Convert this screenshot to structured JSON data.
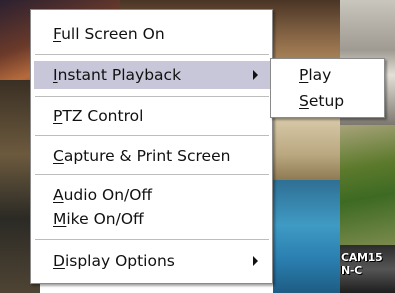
{
  "background": {
    "camera_label": "CAM15 N-C"
  },
  "menu": {
    "items": [
      {
        "first": "F",
        "rest": "ull Screen On",
        "has_submenu": false
      },
      {
        "first": "I",
        "rest": "nstant Playback",
        "has_submenu": true,
        "highlighted": true
      },
      {
        "first": "P",
        "rest": "TZ Control",
        "has_submenu": false
      },
      {
        "first": "C",
        "rest": "apture & Print Screen",
        "has_submenu": false
      },
      {
        "first": "A",
        "rest": "udio On/Off",
        "has_submenu": false
      },
      {
        "first": "M",
        "rest": "ike On/Off",
        "has_submenu": false
      },
      {
        "first": "D",
        "rest": "isplay Options",
        "has_submenu": true
      }
    ]
  },
  "submenu": {
    "items": [
      {
        "first": "P",
        "rest": "lay"
      },
      {
        "first": "S",
        "rest": "etup"
      }
    ]
  },
  "colors": {
    "highlight": "#c7c7d9",
    "menu_bg": "#ffffff"
  }
}
